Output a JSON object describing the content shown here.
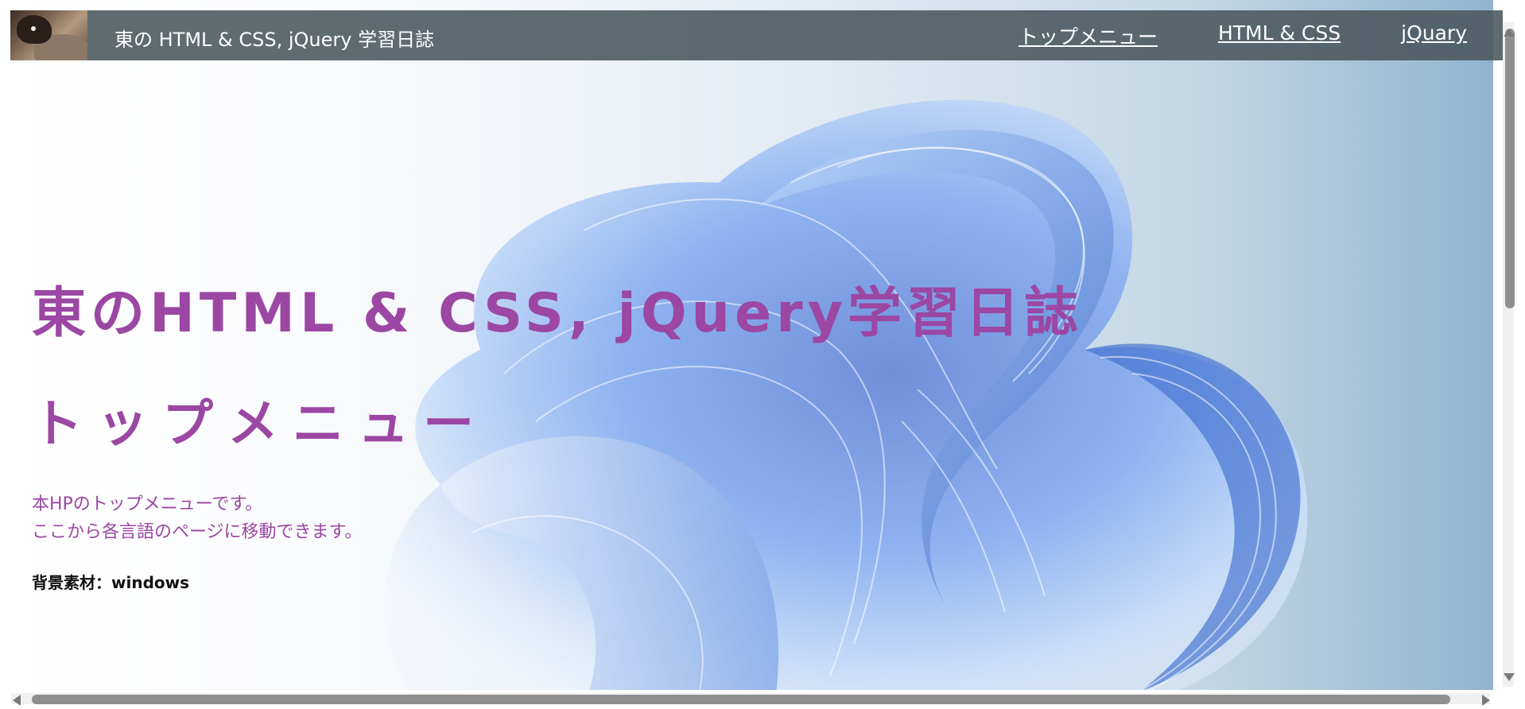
{
  "header": {
    "site_title": "東の HTML & CSS, jQuery 学習日誌",
    "nav": [
      {
        "label": "トップメニュー"
      },
      {
        "label": "HTML & CSS"
      },
      {
        "label": "jQuary"
      }
    ]
  },
  "main": {
    "hero_title": "東のHTML & CSS, jQuery学習日誌",
    "section_title": "トップメニュー",
    "description_line1": "本HPのトップメニューです。",
    "description_line2": "ここから各言語のページに移動できます。",
    "credit": "背景素材：windows"
  },
  "colors": {
    "accent_text": "#9b47a3",
    "header_bg": "#4a565c"
  }
}
